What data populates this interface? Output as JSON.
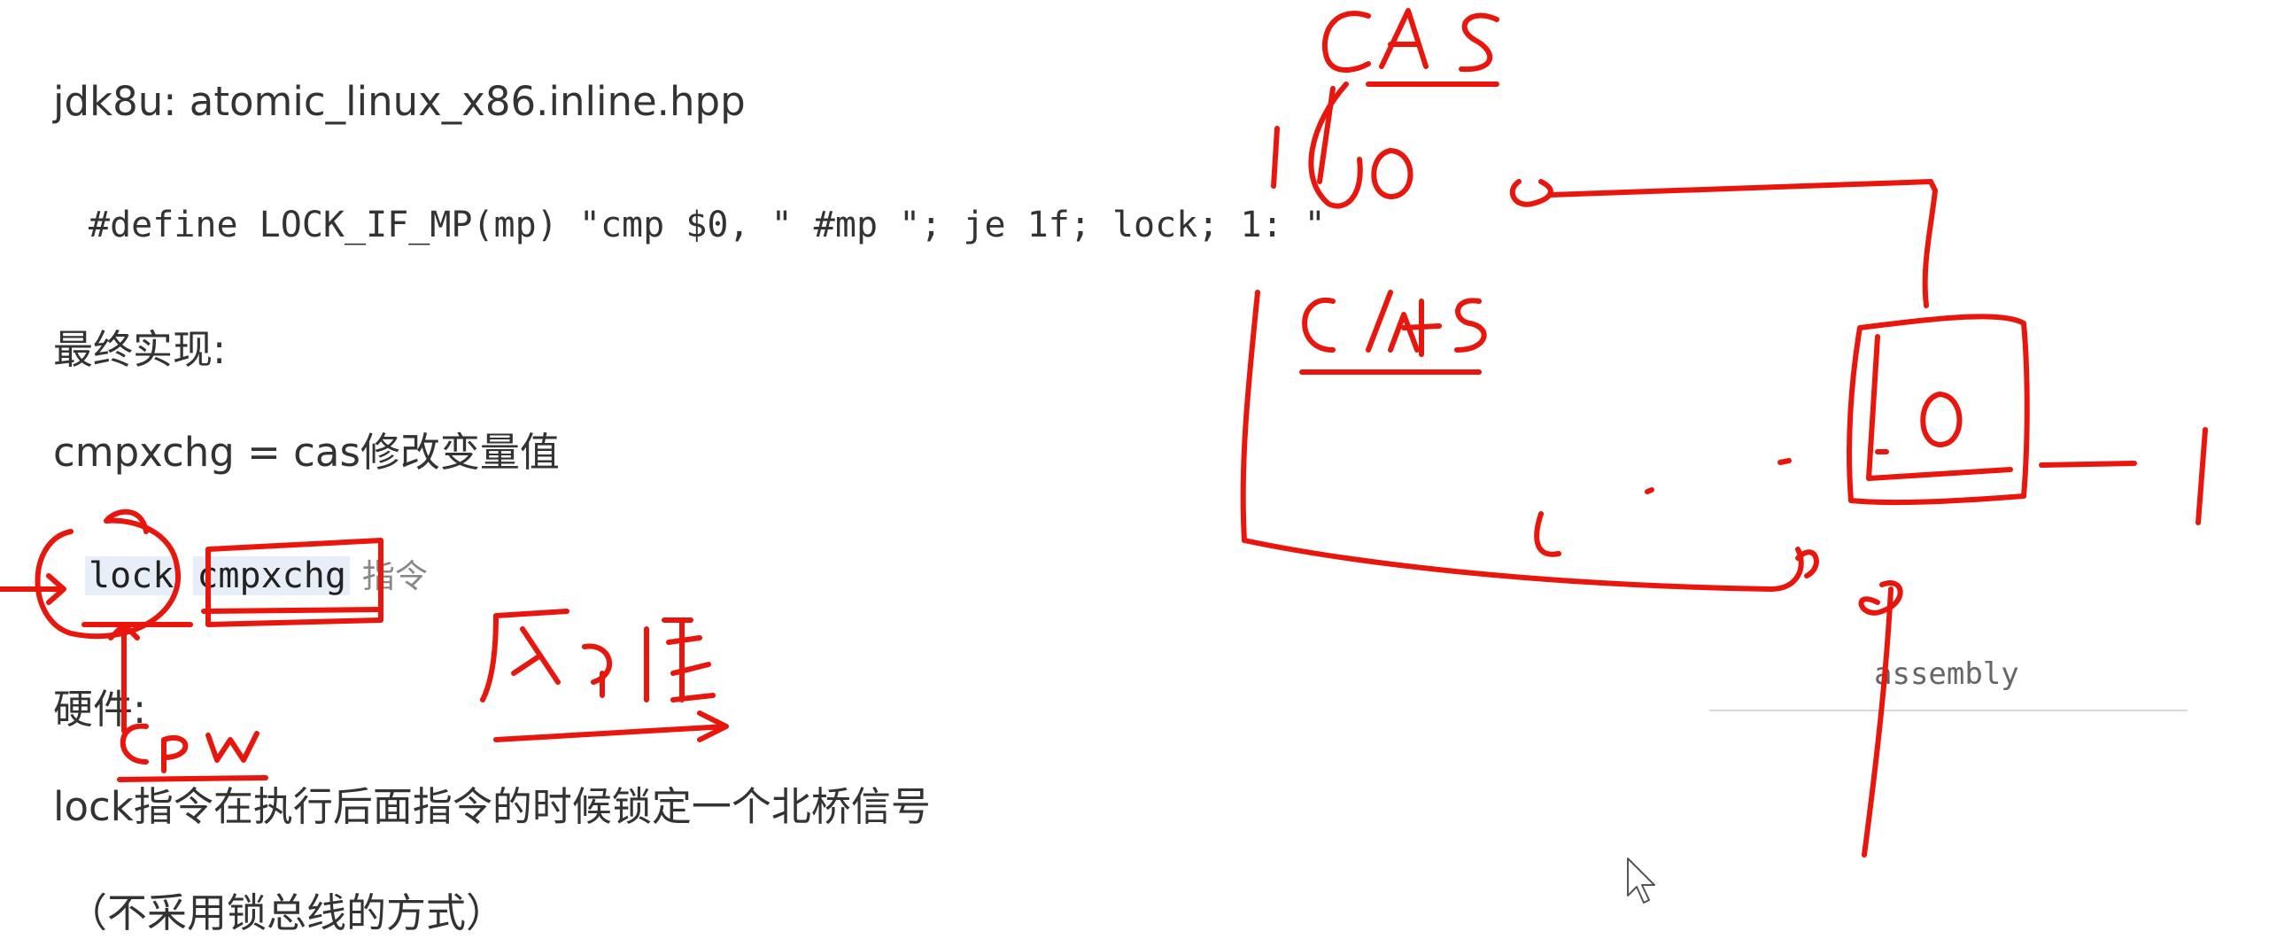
{
  "heading": "jdk8u: atomic_linux_x86.inline.hpp",
  "define_line": "#define LOCK_IF_MP(mp) \"cmp $0, \" #mp \"; je 1f; lock; 1: \"",
  "final_label": "最终实现:",
  "cmpxchg_line": "cmpxchg = cas修改变量值",
  "instruction": {
    "lock": "lock",
    "cmpxchg": "cmpxchg",
    "suffix": "指令"
  },
  "hardware_label": "硬件:",
  "lock_description": "lock指令在执行后面指令的时候锁定一个北桥信号",
  "note": "（不采用锁总线的方式）",
  "assembly_label": "assembly",
  "annotation_color": "#e8160c",
  "annotations": {
    "cas": "CAS",
    "c_plus_5": "C/+5",
    "zero": "0",
    "cpu": "cpu",
    "atomicity": "原子性"
  }
}
